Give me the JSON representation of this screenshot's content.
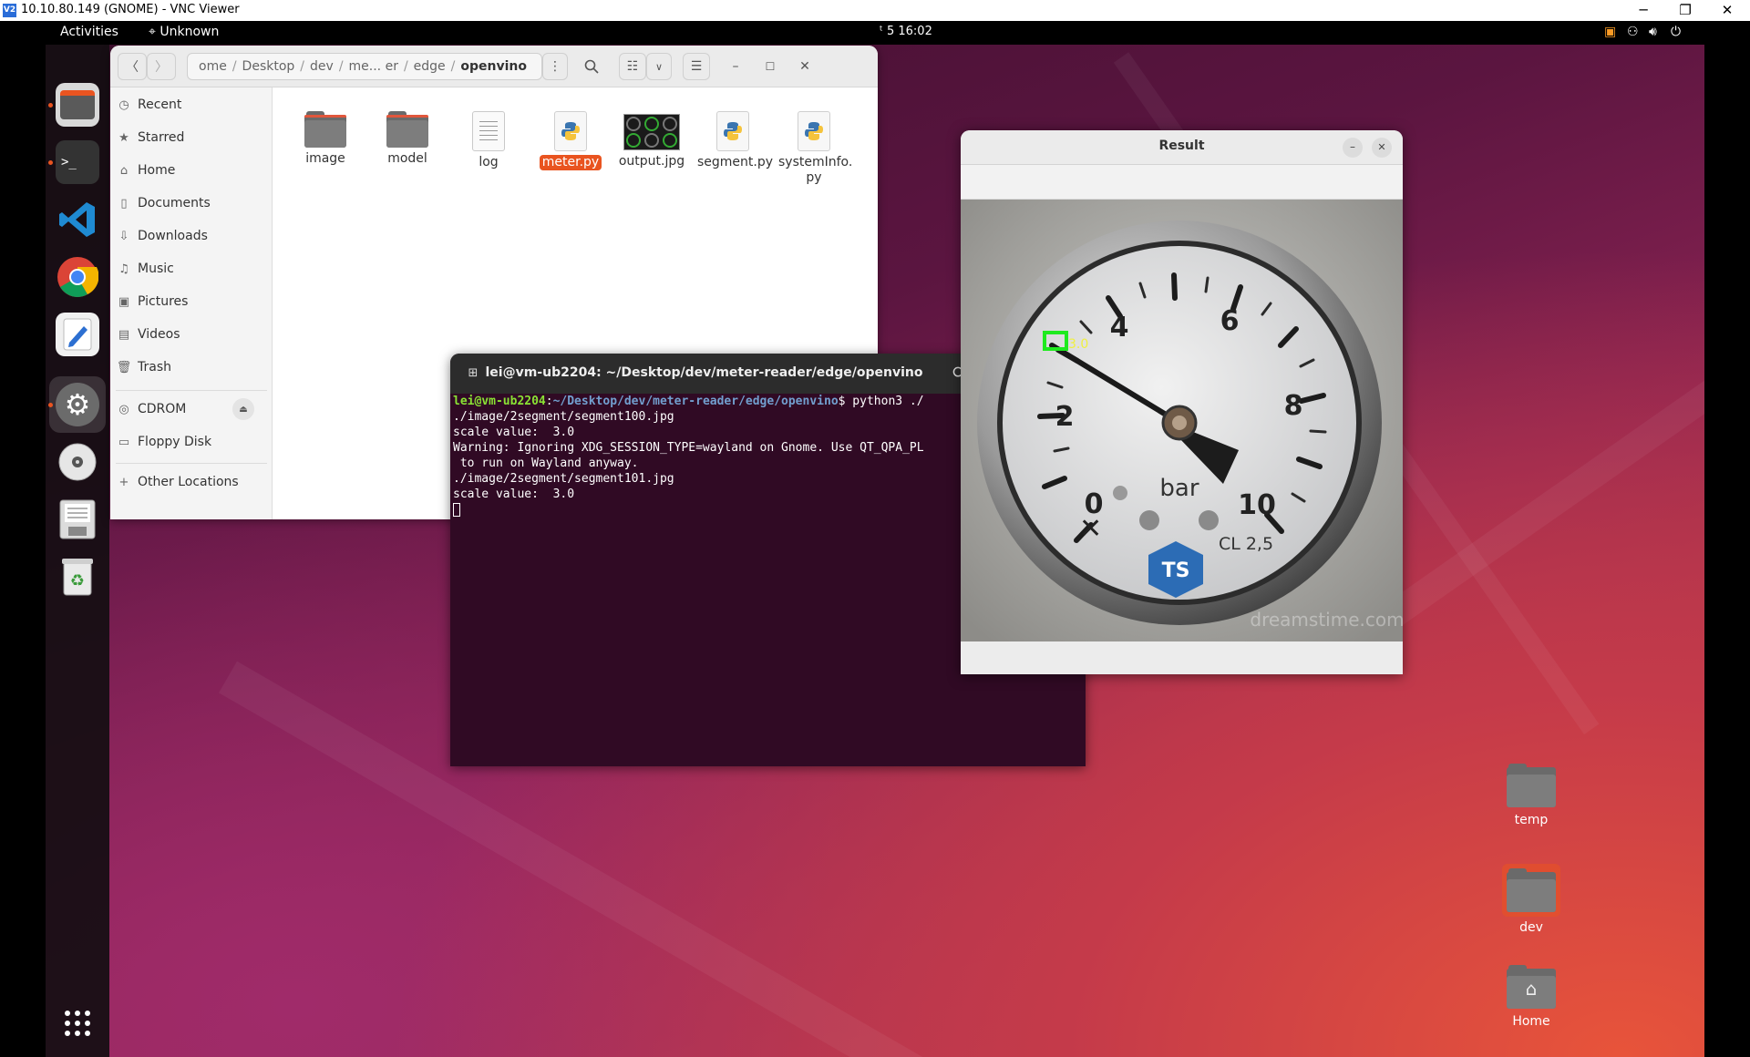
{
  "vnc": {
    "logo": "V2",
    "title": "10.10.80.149 (GNOME) - VNC Viewer",
    "minimize": "─",
    "restore": "❐",
    "close": "✕"
  },
  "topbar": {
    "activities": "Activities",
    "app_name": "Unknown",
    "clock": "ᵗ 5 16:02"
  },
  "dock": {
    "apps": [
      "files-icon",
      "terminal-icon",
      "vscode-icon",
      "chrome-icon",
      "text-editor-icon",
      "settings-icon",
      "disc-icon",
      "floppy-icon",
      "trash-icon"
    ],
    "show_apps": "show-apps-grid-icon"
  },
  "files": {
    "path": [
      "ome",
      "Desktop",
      "dev",
      "me... er",
      "edge",
      "openvino"
    ],
    "sidebar": [
      "Recent",
      "Starred",
      "Home",
      "Documents",
      "Downloads",
      "Music",
      "Pictures",
      "Videos",
      "Trash",
      "CDROM",
      "Floppy Disk",
      "Other Locations"
    ],
    "items": [
      {
        "name": "image",
        "type": "folder"
      },
      {
        "name": "model",
        "type": "folder"
      },
      {
        "name": "log",
        "type": "text"
      },
      {
        "name": "meter.py",
        "type": "python",
        "selected": true
      },
      {
        "name": "output.jpg",
        "type": "image"
      },
      {
        "name": "segment.py",
        "type": "python"
      },
      {
        "name": "systemInfo.\npy",
        "type": "python"
      }
    ]
  },
  "terminal": {
    "title": "lei@vm-ub2204: ~/Desktop/dev/meter-reader/edge/openvino",
    "prompt_user": "lei@vm-ub2204",
    "prompt_path": "~/Desktop/dev/meter-reader/edge/openvino",
    "prompt_cmd": "$ python3 ./",
    "lines": [
      "./image/2segment/segment100.jpg",
      "scale value:  3.0",
      "Warning: Ignoring XDG_SESSION_TYPE=wayland on Gnome. Use QT_QPA_PL",
      " to run on Wayland anyway.",
      "./image/2segment/segment101.jpg",
      "scale value:  3.0"
    ]
  },
  "result": {
    "title": "Result",
    "overlay_value": "3.0",
    "gauge_unit": "bar",
    "gauge_class": "CL 2,5",
    "gauge_brand": "TS",
    "gauge_numbers": [
      "0",
      "2",
      "4",
      "6",
      "8",
      "10"
    ],
    "watermark": "dreamstime.com"
  },
  "desktop": {
    "icons": [
      "temp",
      "dev",
      "Home"
    ]
  }
}
